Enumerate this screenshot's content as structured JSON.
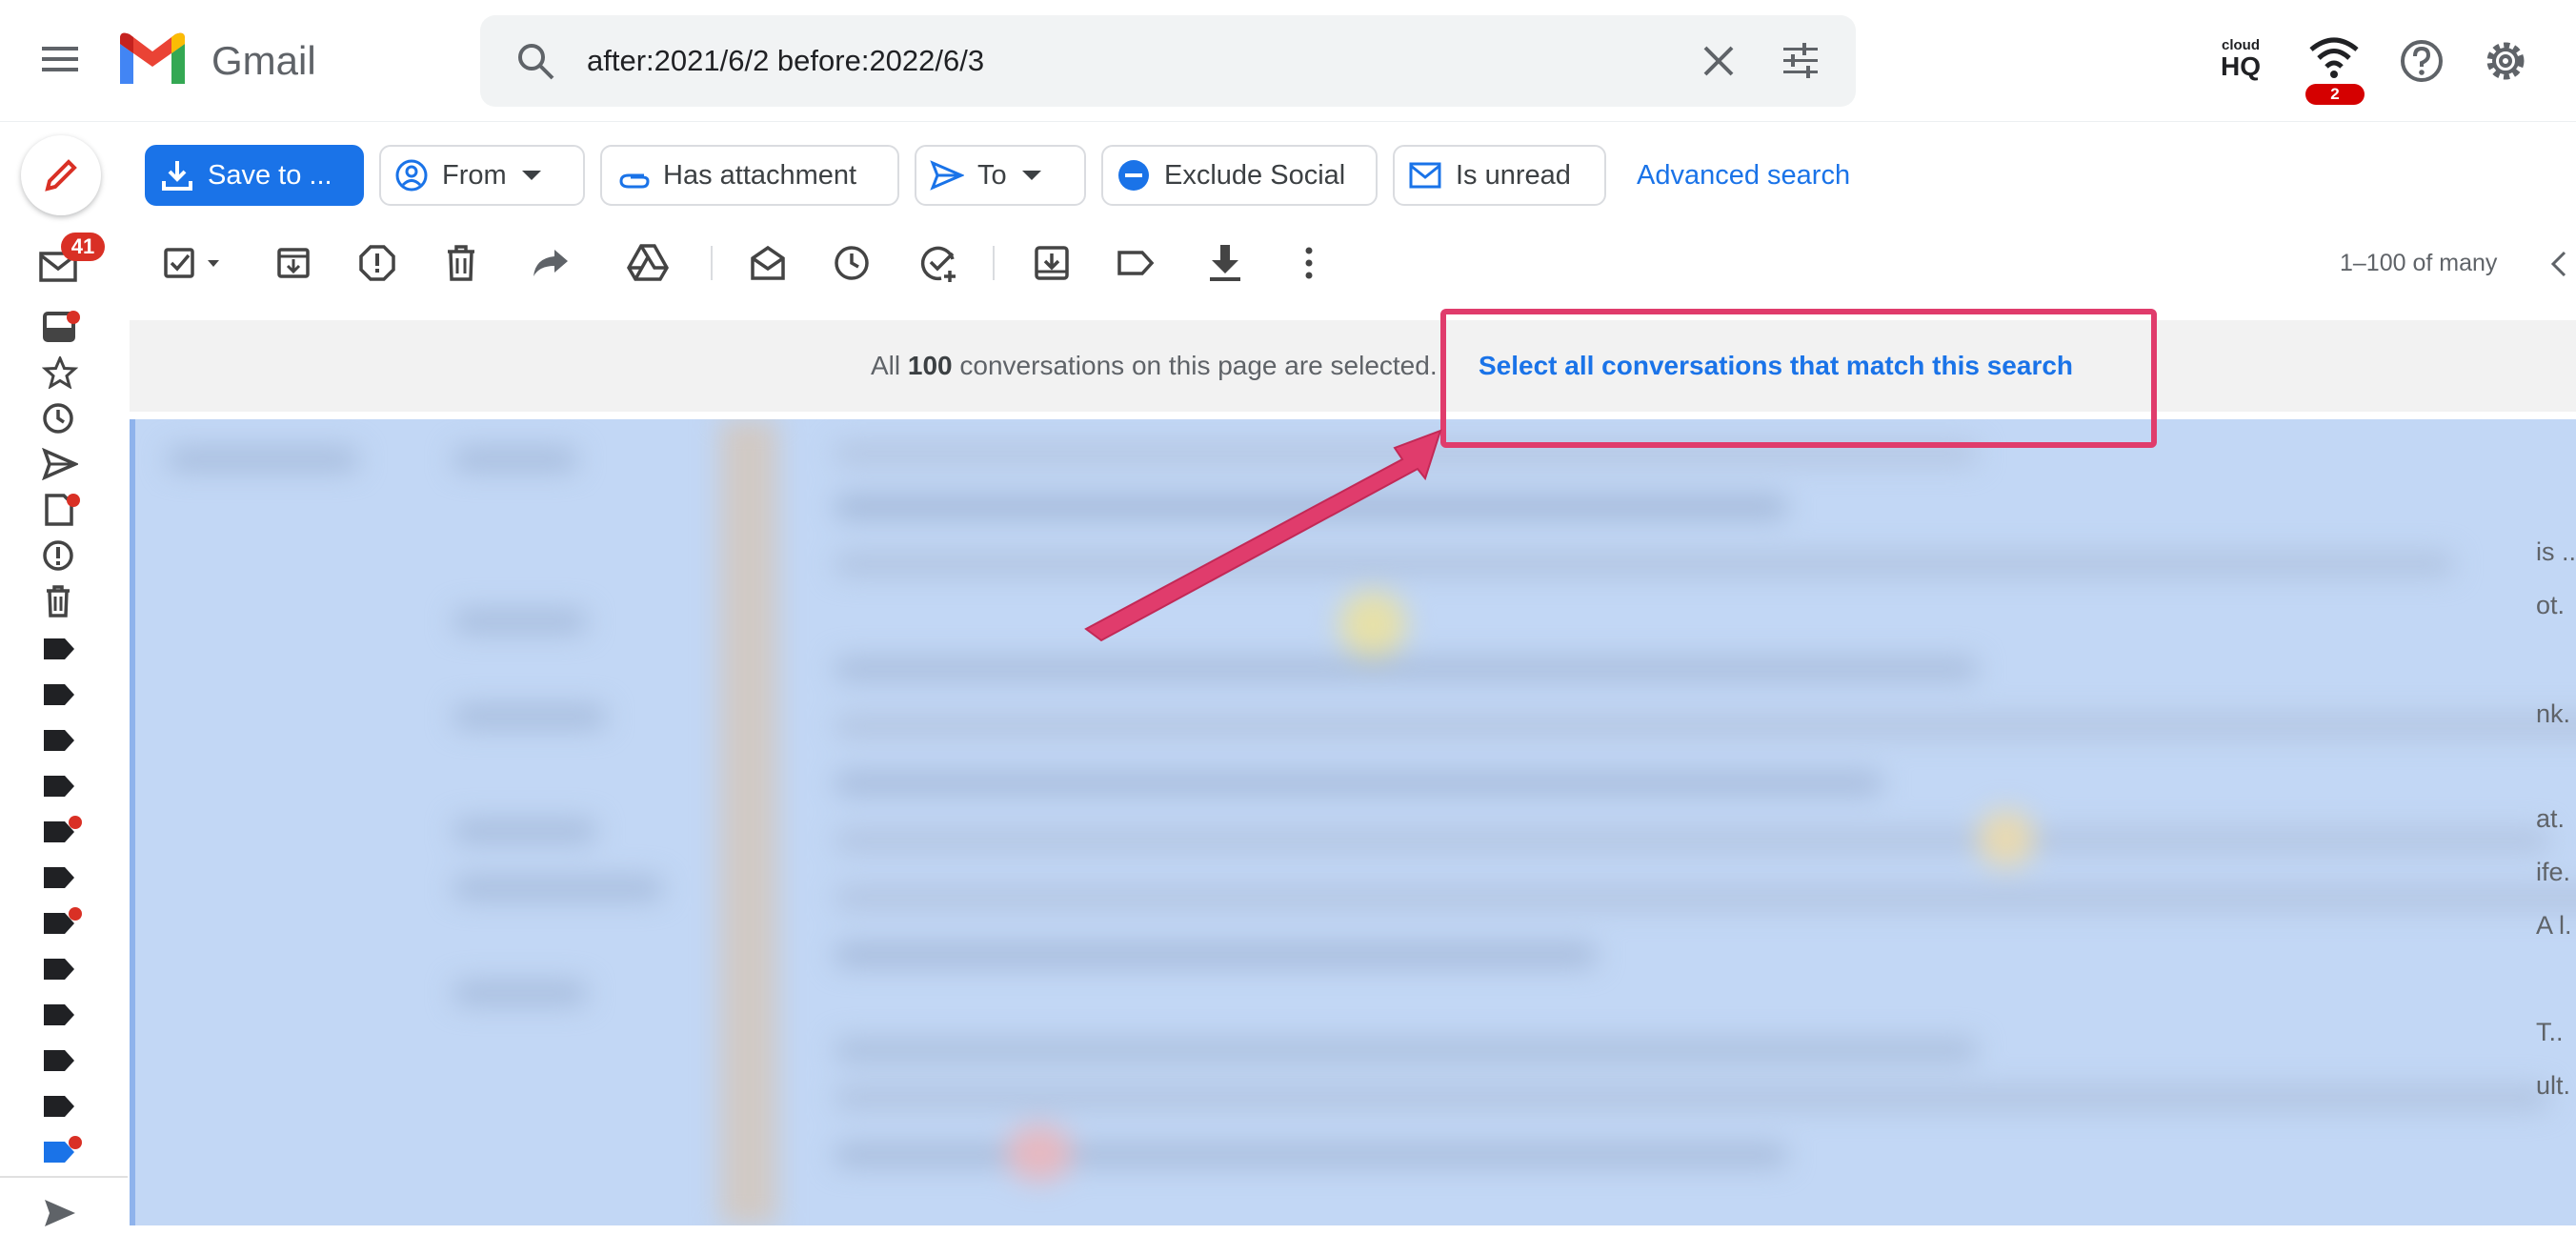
{
  "header": {
    "app_name": "Gmail",
    "search_query": "after:2021/6/2 before:2022/6/3",
    "cloudhq_line1": "cloud",
    "cloudhq_line2": "HQ",
    "notification_count": "2"
  },
  "rail": {
    "inbox_badge": "41"
  },
  "filters": {
    "save_to": "Save to ...",
    "from": "From",
    "has_attachment": "Has attachment",
    "to": "To",
    "exclude_social": "Exclude Social",
    "is_unread": "Is unread",
    "advanced_search": "Advanced search"
  },
  "toolbar": {
    "pagination": "1–100 of many"
  },
  "banner": {
    "prefix": "All ",
    "count": "100",
    "suffix": " conversations on this page are selected.",
    "select_all_link": "Select all conversations that match this search"
  },
  "list_snippets": [
    "is ..",
    "ot.",
    "nk.",
    "at.",
    "ife.",
    "A l.",
    "T..",
    "ult."
  ],
  "colors": {
    "accent_blue": "#1a73e8",
    "selected_row_bg": "#c2d7f5",
    "badge_red": "#d93025",
    "annotation_pink": "#e03c6c"
  }
}
